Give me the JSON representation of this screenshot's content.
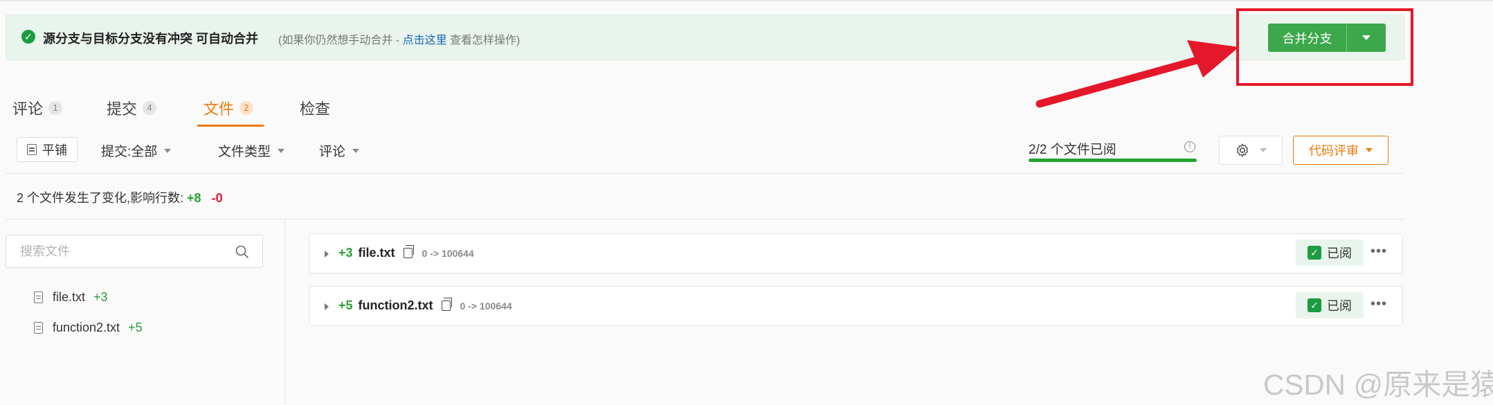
{
  "banner": {
    "message": "源分支与目标分支没有冲突 可自动合并",
    "hint_prefix": "(如果你仍然想手动合并 - ",
    "hint_link": "点击这里",
    "hint_suffix": " 查看怎样操作)",
    "merge_button": "合并分支"
  },
  "tabs": [
    {
      "label": "评论",
      "count": "1"
    },
    {
      "label": "提交",
      "count": "4"
    },
    {
      "label": "文件",
      "count": "2",
      "active": true
    },
    {
      "label": "检查",
      "count": ""
    }
  ],
  "toolbar": {
    "flat_label": "平铺",
    "commit_filter": "提交:全部",
    "filetype_filter": "文件类型",
    "comment_filter": "评论",
    "viewed_status": "2/2 个文件已阅",
    "viewed_fraction": 1.0,
    "review_button": "代码评审"
  },
  "summary": {
    "text": "2 个文件发生了变化,影响行数:",
    "added": "+8",
    "removed": "-0"
  },
  "tree": {
    "search_placeholder": "搜索文件",
    "items": [
      {
        "name": "file.txt",
        "added": "+3"
      },
      {
        "name": "function2.txt",
        "added": "+5"
      }
    ]
  },
  "files": [
    {
      "added": "+3",
      "name": "file.txt",
      "mode": "0 -> 100644",
      "viewed_label": "已阅"
    },
    {
      "added": "+5",
      "name": "function2.txt",
      "mode": "0 -> 100644",
      "viewed_label": "已阅"
    }
  ],
  "watermark": "CSDN @原来是猿",
  "colors": {
    "accent_orange": "#f0780a",
    "merge_green": "#3ca84b",
    "annotation_red": "#e4182a"
  }
}
